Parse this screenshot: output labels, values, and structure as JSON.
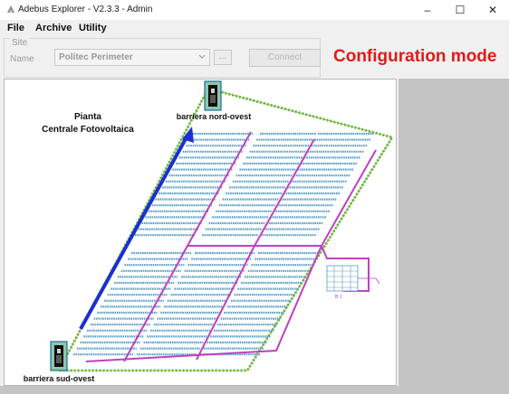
{
  "window": {
    "title": "Adebus Explorer - V2.3.3 - Admin",
    "controls": [
      "–",
      "☐",
      "✕"
    ]
  },
  "menu": {
    "items": [
      "File",
      "Archive",
      "Utility"
    ]
  },
  "site": {
    "group_label": "Site",
    "name_label": "Name",
    "selected_site": "Politec Perimeter",
    "browse_label": "...",
    "connect_label": "Connect"
  },
  "mode_banner": "Configuration mode",
  "map": {
    "title_line1": "Pianta",
    "title_line2": "Centrale Fotovoltaica",
    "gates": [
      {
        "label": "barriera nord-ovest"
      },
      {
        "label": "barriera sud-ovest"
      }
    ],
    "inset_label": "B 1"
  },
  "colors": {
    "accent_red": "#e01b1b",
    "fence_green": "#7ac143",
    "cable_magenta": "#c040c0",
    "panel_blue": "#5a9fc8",
    "arrow_blue": "#1a30d0"
  }
}
